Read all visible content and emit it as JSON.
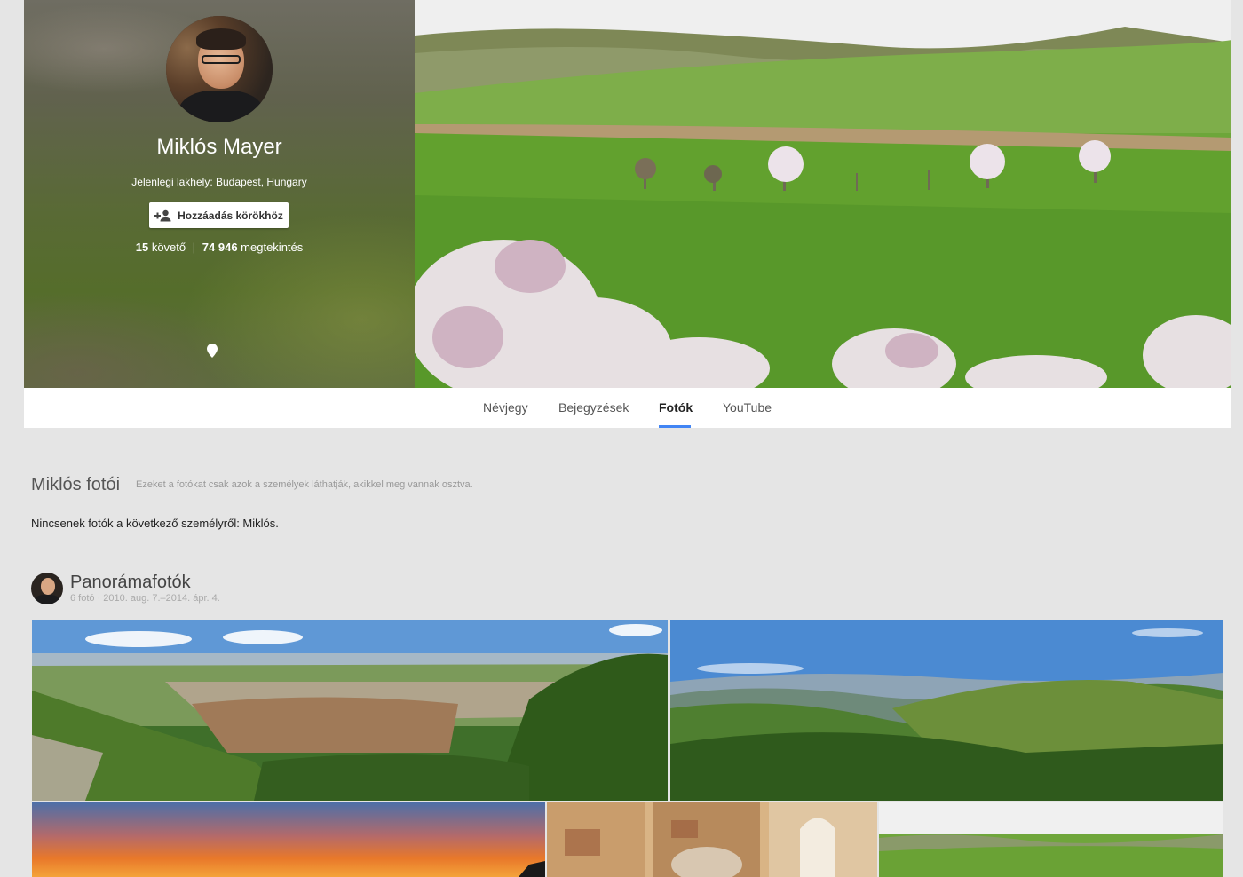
{
  "profile": {
    "name": "Miklós Mayer",
    "location": "Jelenlegi lakhely: Budapest, Hungary",
    "add_button_label": "Hozzáadás körökhöz",
    "followers_count": "15",
    "followers_label": "követő",
    "separator": "|",
    "views_count": "74 946",
    "views_label": "megtekintés"
  },
  "tabs": [
    {
      "label": "Névjegy",
      "active": false
    },
    {
      "label": "Bejegyzések",
      "active": false
    },
    {
      "label": "Fotók",
      "active": true
    },
    {
      "label": "YouTube",
      "active": false
    }
  ],
  "photos_section": {
    "title": "Miklós fotói",
    "note": "Ezeket a fotókat csak azok a személyek láthatják, akikkel meg vannak osztva.",
    "empty_message": "Nincsenek fotók a következő személyről: Miklós."
  },
  "album": {
    "title": "Panorámafotók",
    "meta": "6 fotó  ·  2010. aug. 7.–2014. ápr. 4."
  },
  "icons": {
    "add_person": "person-add-icon",
    "location": "location-pin-icon"
  },
  "colors": {
    "accent": "#4285f4",
    "background": "#e5e5e5"
  }
}
